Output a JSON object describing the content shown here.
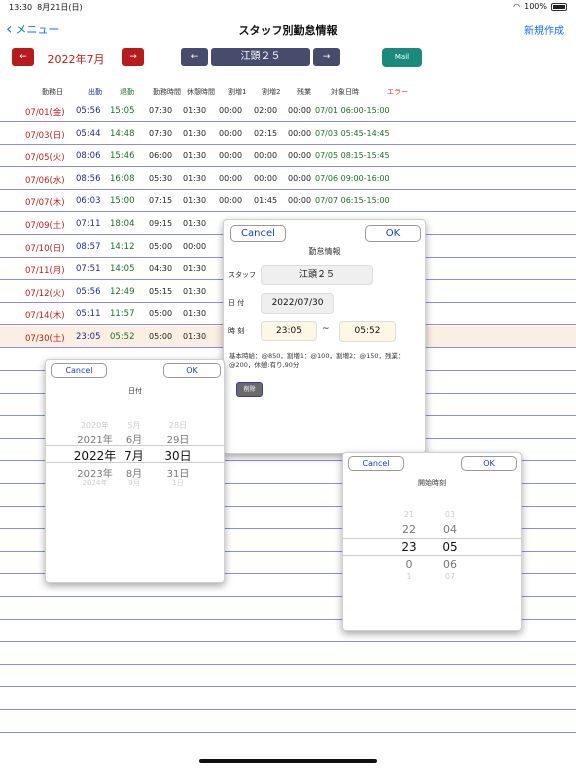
{
  "status": {
    "time": "13:30",
    "date": "8月21日(日)",
    "battery": "100%"
  },
  "nav": {
    "back": "メニュー",
    "title": "スタッフ別勤怠情報",
    "new": "新規作成"
  },
  "toolbar": {
    "prev": "←",
    "month": "2022年7月",
    "next": "→",
    "staff_prev": "←",
    "staff": "江頭２５",
    "staff_next": "→",
    "mail": "Mail"
  },
  "headers": [
    "勤務日",
    "出勤",
    "退勤",
    "勤務時間",
    "休憩時間",
    "割増1",
    "割増2",
    "残業",
    "対象日時",
    "エラー"
  ],
  "rows": [
    {
      "date": "07/01(金)",
      "in": "05:56",
      "out": "15:05",
      "work": "07:30",
      "rest": "01:30",
      "p1": "00:00",
      "p2": "02:00",
      "ot": "00:00",
      "range": "07/01 06:00-15:00"
    },
    {
      "date": "07/03(日)",
      "in": "05:44",
      "out": "14:48",
      "work": "07:30",
      "rest": "01:30",
      "p1": "00:00",
      "p2": "02:15",
      "ot": "00:00",
      "range": "07/03 05:45-14:45"
    },
    {
      "date": "07/05(火)",
      "in": "08:06",
      "out": "15:46",
      "work": "06:00",
      "rest": "01:30",
      "p1": "00:00",
      "p2": "00:00",
      "ot": "00:00",
      "range": "07/05 08:15-15:45"
    },
    {
      "date": "07/06(水)",
      "in": "08:56",
      "out": "16:08",
      "work": "05:30",
      "rest": "01:30",
      "p1": "00:00",
      "p2": "00:00",
      "ot": "00:00",
      "range": "07/06 09:00-16:00"
    },
    {
      "date": "07/07(木)",
      "in": "06:03",
      "out": "15:00",
      "work": "07:15",
      "rest": "01:30",
      "p1": "00:00",
      "p2": "01:45",
      "ot": "00:00",
      "range": "07/07 06:15-15:00"
    },
    {
      "date": "07/09(土)",
      "in": "07:11",
      "out": "18:04",
      "work": "09:15",
      "rest": "01:30",
      "p1": "",
      "p2": "",
      "ot": "",
      "range": ""
    },
    {
      "date": "07/10(日)",
      "in": "08:57",
      "out": "14:12",
      "work": "05:00",
      "rest": "00:00",
      "p1": "",
      "p2": "",
      "ot": "",
      "range": ""
    },
    {
      "date": "07/11(月)",
      "in": "07:51",
      "out": "14:05",
      "work": "04:30",
      "rest": "01:30",
      "p1": "",
      "p2": "",
      "ot": "",
      "range": ""
    },
    {
      "date": "07/12(火)",
      "in": "05:56",
      "out": "12:49",
      "work": "05:15",
      "rest": "01:30",
      "p1": "",
      "p2": "",
      "ot": "",
      "range": ""
    },
    {
      "date": "07/14(木)",
      "in": "05:11",
      "out": "11:57",
      "work": "05:00",
      "rest": "01:30",
      "p1": "",
      "p2": "",
      "ot": "",
      "range": ""
    },
    {
      "date": "07/30(土)",
      "in": "23:05",
      "out": "05:52",
      "work": "05:00",
      "rest": "01:30",
      "p1": "",
      "p2": "",
      "ot": "",
      "range": ""
    }
  ],
  "dialog": {
    "cancel": "Cancel",
    "ok": "OK",
    "title": "勤怠情報",
    "staff_label": "スタッフ",
    "staff_value": "江頭２５",
    "date_label": "日 付",
    "date_value": "2022/07/30",
    "time_label": "時 刻",
    "start": "23:05",
    "tilde": "~",
    "end": "05:52",
    "info": "基本時給：@850，割増1：@100，割増2：@150，残業：@200，休憩:有り,90分",
    "delete": "削除"
  },
  "date_picker": {
    "cancel": "Cancel",
    "ok": "OK",
    "title": "日付",
    "years": [
      "2020年",
      "2021年",
      "2022年",
      "2023年",
      "2024年"
    ],
    "months": [
      "5月",
      "6月",
      "7月",
      "8月",
      "9月"
    ],
    "days": [
      "28日",
      "29日",
      "30日",
      "31日",
      "1日"
    ]
  },
  "time_picker": {
    "cancel": "Cancel",
    "ok": "OK",
    "title": "開始時刻",
    "hours": [
      "21",
      "22",
      "23",
      "0",
      "1"
    ],
    "minutes": [
      "03",
      "04",
      "05",
      "06",
      "07"
    ]
  },
  "colors": {
    "red": "#b71c1c",
    "navy": "#474c6c",
    "teal": "#1b8a7c",
    "link": "#1a6de0",
    "rowline": "#8b8fd8",
    "selected": "#fbeee2"
  }
}
